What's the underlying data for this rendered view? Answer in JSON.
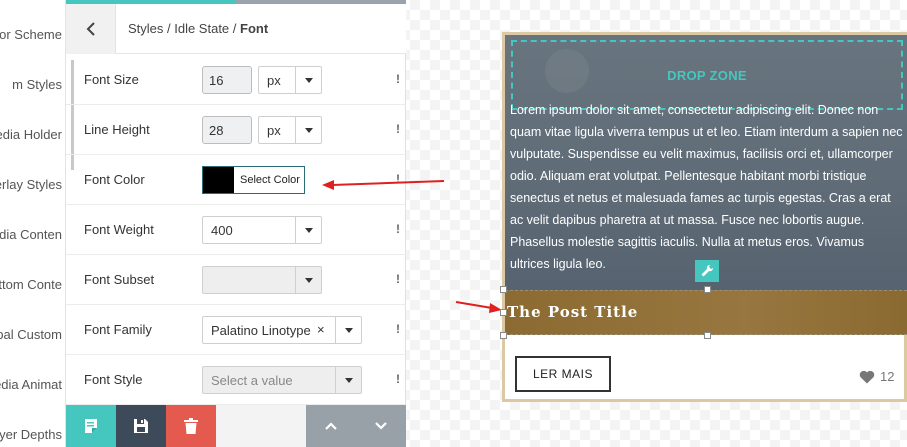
{
  "sidebar_strip": {
    "items": [
      "olor Scheme",
      "m Styles",
      "edia Holder",
      "erlay Styles",
      "edia Conten",
      "ttom Conte",
      "obal Custom",
      "edia Animat",
      "yer Depths"
    ]
  },
  "panel": {
    "breadcrumb": {
      "path": "Styles / Idle State / ",
      "current": "Font"
    },
    "rows": {
      "font_size": {
        "label": "Font Size",
        "value": "16",
        "unit": "px"
      },
      "line_height": {
        "label": "Line Height",
        "value": "28",
        "unit": "px"
      },
      "font_color": {
        "label": "Font Color",
        "button": "Select Color",
        "swatch": "#000000"
      },
      "font_weight": {
        "label": "Font Weight",
        "value": "400"
      },
      "font_subset": {
        "label": "Font Subset",
        "value": ""
      },
      "font_family": {
        "label": "Font Family",
        "value": "Palatino Linotype",
        "remove": "×"
      },
      "font_style": {
        "label": "Font Style",
        "placeholder": "Select a value"
      }
    },
    "warn_mark": "!"
  },
  "toolbar": {
    "colors": {
      "notes": "#45c7c0",
      "save": "#3d4a5a",
      "delete": "#e55a4e",
      "nav": "#99a1a8"
    }
  },
  "preview": {
    "drop_zone": "DROP ZONE",
    "body_text": "Lorem ipsum dolor sit amet, consectetur adipiscing elit. Donec non quam vitae ligula viverra tempus ut et leo. Etiam interdum a sapien nec vulputate. Suspendisse eu velit maximus, facilisis orci et, ullamcorper odio. Aliquam erat volutpat. Pellentesque habitant morbi tristique senectus et netus et malesuada fames ac turpis egestas. Cras a erat ac velit dapibus pharetra at ut massa. Fusce nec lobortis augue. Phasellus molestie sagittis iaculis. Nulla at metus eros. Vivamus ultrices ligula leo.",
    "post_title": "The Post Title",
    "read_more": "LER MAIS",
    "likes": "12"
  },
  "accent": "#45c7c0",
  "annotation_color": "#e02020"
}
